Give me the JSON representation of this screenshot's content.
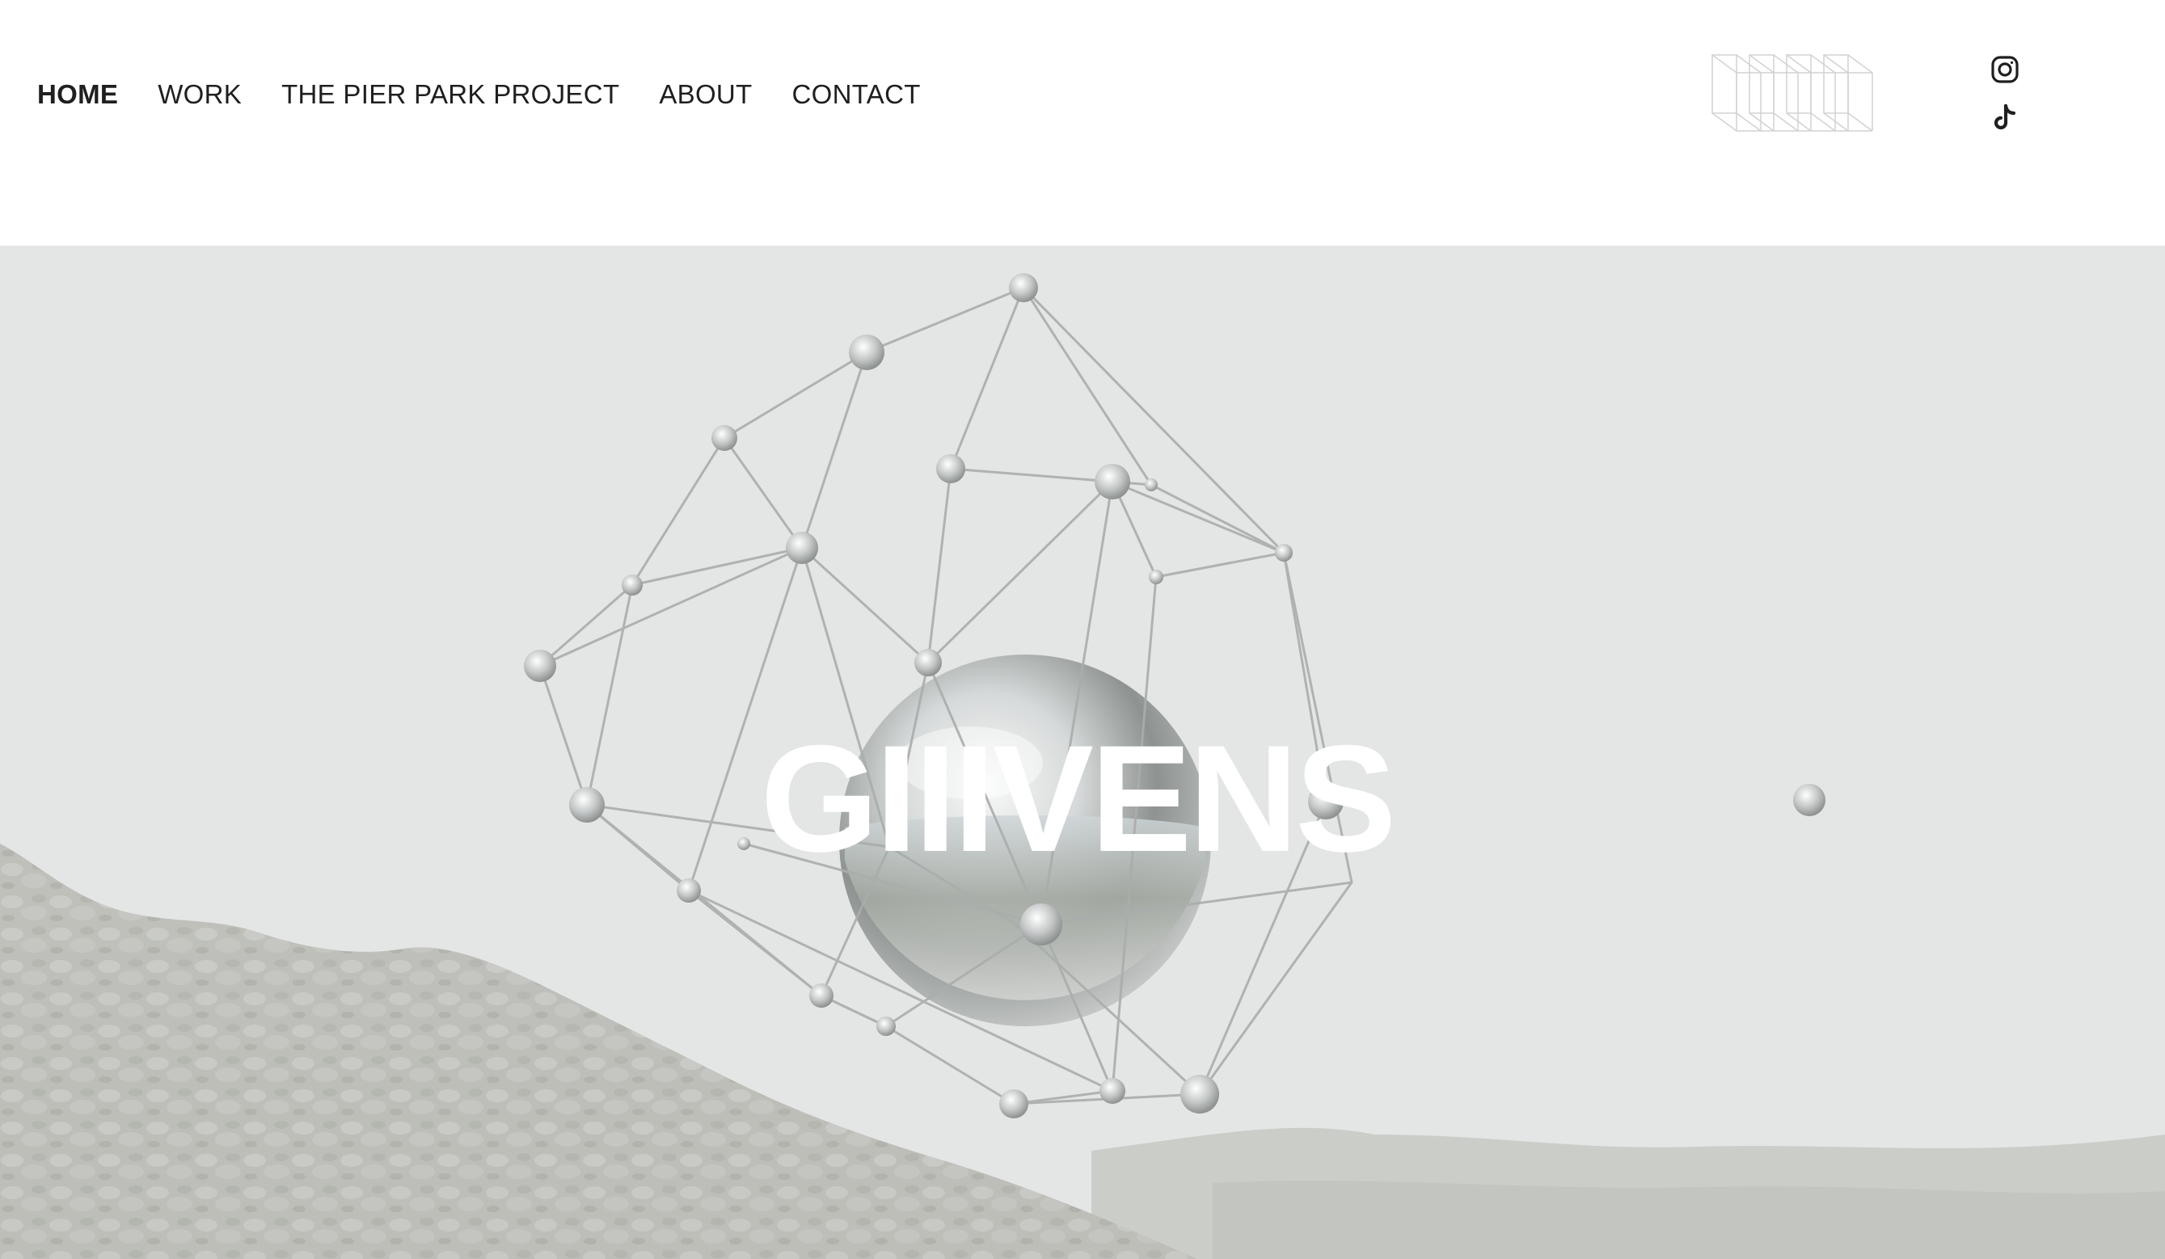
{
  "nav": {
    "items": [
      {
        "label": "HOME",
        "active": true
      },
      {
        "label": "WORK",
        "active": false
      },
      {
        "label": "THE PIER PARK PROJECT",
        "active": false
      },
      {
        "label": "ABOUT",
        "active": false
      },
      {
        "label": "CONTACT",
        "active": false
      }
    ]
  },
  "header": {
    "logo_icon": "outlined-3d-block-letters-logo",
    "social": [
      "instagram-icon",
      "tiktok-icon"
    ]
  },
  "hero": {
    "title": "GIIIVENS",
    "background_color": "#e2e4e3",
    "title_color": "#ffffff"
  },
  "colors": {
    "nav_text": "#1f1f1f",
    "page_background": "#ffffff"
  }
}
